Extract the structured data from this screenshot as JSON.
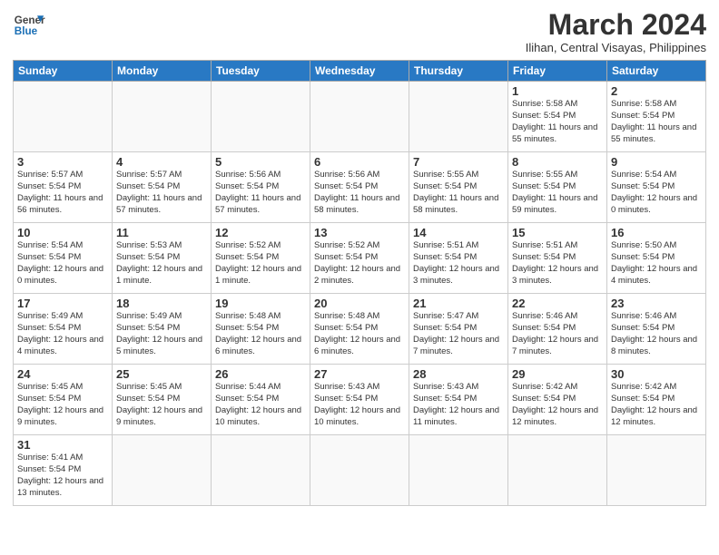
{
  "header": {
    "logo_line1": "General",
    "logo_line2": "Blue",
    "title": "March 2024",
    "subtitle": "Ilihan, Central Visayas, Philippines"
  },
  "weekdays": [
    "Sunday",
    "Monday",
    "Tuesday",
    "Wednesday",
    "Thursday",
    "Friday",
    "Saturday"
  ],
  "weeks": [
    [
      {
        "day": "",
        "info": ""
      },
      {
        "day": "",
        "info": ""
      },
      {
        "day": "",
        "info": ""
      },
      {
        "day": "",
        "info": ""
      },
      {
        "day": "",
        "info": ""
      },
      {
        "day": "1",
        "info": "Sunrise: 5:58 AM\nSunset: 5:54 PM\nDaylight: 11 hours\nand 55 minutes."
      },
      {
        "day": "2",
        "info": "Sunrise: 5:58 AM\nSunset: 5:54 PM\nDaylight: 11 hours\nand 55 minutes."
      }
    ],
    [
      {
        "day": "3",
        "info": "Sunrise: 5:57 AM\nSunset: 5:54 PM\nDaylight: 11 hours\nand 56 minutes."
      },
      {
        "day": "4",
        "info": "Sunrise: 5:57 AM\nSunset: 5:54 PM\nDaylight: 11 hours\nand 57 minutes."
      },
      {
        "day": "5",
        "info": "Sunrise: 5:56 AM\nSunset: 5:54 PM\nDaylight: 11 hours\nand 57 minutes."
      },
      {
        "day": "6",
        "info": "Sunrise: 5:56 AM\nSunset: 5:54 PM\nDaylight: 11 hours\nand 58 minutes."
      },
      {
        "day": "7",
        "info": "Sunrise: 5:55 AM\nSunset: 5:54 PM\nDaylight: 11 hours\nand 58 minutes."
      },
      {
        "day": "8",
        "info": "Sunrise: 5:55 AM\nSunset: 5:54 PM\nDaylight: 11 hours\nand 59 minutes."
      },
      {
        "day": "9",
        "info": "Sunrise: 5:54 AM\nSunset: 5:54 PM\nDaylight: 12 hours\nand 0 minutes."
      }
    ],
    [
      {
        "day": "10",
        "info": "Sunrise: 5:54 AM\nSunset: 5:54 PM\nDaylight: 12 hours\nand 0 minutes."
      },
      {
        "day": "11",
        "info": "Sunrise: 5:53 AM\nSunset: 5:54 PM\nDaylight: 12 hours\nand 1 minute."
      },
      {
        "day": "12",
        "info": "Sunrise: 5:52 AM\nSunset: 5:54 PM\nDaylight: 12 hours\nand 1 minute."
      },
      {
        "day": "13",
        "info": "Sunrise: 5:52 AM\nSunset: 5:54 PM\nDaylight: 12 hours\nand 2 minutes."
      },
      {
        "day": "14",
        "info": "Sunrise: 5:51 AM\nSunset: 5:54 PM\nDaylight: 12 hours\nand 3 minutes."
      },
      {
        "day": "15",
        "info": "Sunrise: 5:51 AM\nSunset: 5:54 PM\nDaylight: 12 hours\nand 3 minutes."
      },
      {
        "day": "16",
        "info": "Sunrise: 5:50 AM\nSunset: 5:54 PM\nDaylight: 12 hours\nand 4 minutes."
      }
    ],
    [
      {
        "day": "17",
        "info": "Sunrise: 5:49 AM\nSunset: 5:54 PM\nDaylight: 12 hours\nand 4 minutes."
      },
      {
        "day": "18",
        "info": "Sunrise: 5:49 AM\nSunset: 5:54 PM\nDaylight: 12 hours\nand 5 minutes."
      },
      {
        "day": "19",
        "info": "Sunrise: 5:48 AM\nSunset: 5:54 PM\nDaylight: 12 hours\nand 6 minutes."
      },
      {
        "day": "20",
        "info": "Sunrise: 5:48 AM\nSunset: 5:54 PM\nDaylight: 12 hours\nand 6 minutes."
      },
      {
        "day": "21",
        "info": "Sunrise: 5:47 AM\nSunset: 5:54 PM\nDaylight: 12 hours\nand 7 minutes."
      },
      {
        "day": "22",
        "info": "Sunrise: 5:46 AM\nSunset: 5:54 PM\nDaylight: 12 hours\nand 7 minutes."
      },
      {
        "day": "23",
        "info": "Sunrise: 5:46 AM\nSunset: 5:54 PM\nDaylight: 12 hours\nand 8 minutes."
      }
    ],
    [
      {
        "day": "24",
        "info": "Sunrise: 5:45 AM\nSunset: 5:54 PM\nDaylight: 12 hours\nand 9 minutes."
      },
      {
        "day": "25",
        "info": "Sunrise: 5:45 AM\nSunset: 5:54 PM\nDaylight: 12 hours\nand 9 minutes."
      },
      {
        "day": "26",
        "info": "Sunrise: 5:44 AM\nSunset: 5:54 PM\nDaylight: 12 hours\nand 10 minutes."
      },
      {
        "day": "27",
        "info": "Sunrise: 5:43 AM\nSunset: 5:54 PM\nDaylight: 12 hours\nand 10 minutes."
      },
      {
        "day": "28",
        "info": "Sunrise: 5:43 AM\nSunset: 5:54 PM\nDaylight: 12 hours\nand 11 minutes."
      },
      {
        "day": "29",
        "info": "Sunrise: 5:42 AM\nSunset: 5:54 PM\nDaylight: 12 hours\nand 12 minutes."
      },
      {
        "day": "30",
        "info": "Sunrise: 5:42 AM\nSunset: 5:54 PM\nDaylight: 12 hours\nand 12 minutes."
      }
    ],
    [
      {
        "day": "31",
        "info": "Sunrise: 5:41 AM\nSunset: 5:54 PM\nDaylight: 12 hours\nand 13 minutes."
      },
      {
        "day": "",
        "info": ""
      },
      {
        "day": "",
        "info": ""
      },
      {
        "day": "",
        "info": ""
      },
      {
        "day": "",
        "info": ""
      },
      {
        "day": "",
        "info": ""
      },
      {
        "day": "",
        "info": ""
      }
    ]
  ]
}
